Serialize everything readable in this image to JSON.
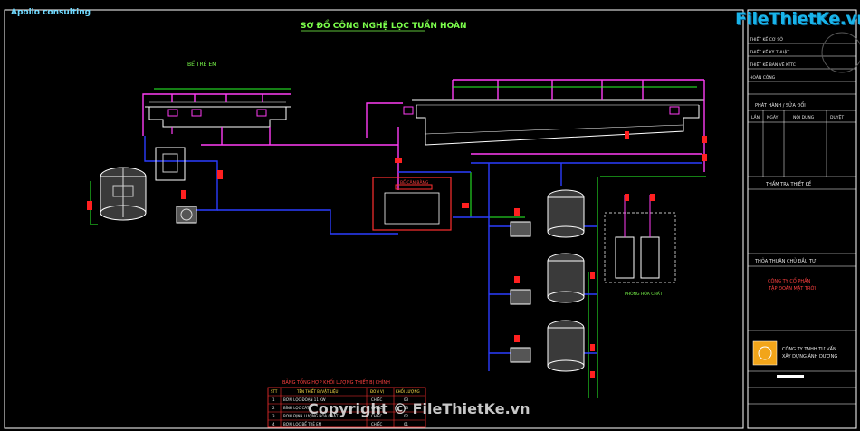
{
  "header": {
    "company": "Apollo consulting",
    "title": "SƠ ĐỒ CÔNG NGHỆ LỌC TUẦN HOÀN"
  },
  "brand": {
    "logo_text": "FileThietKe.vn",
    "copyright": "Copyright © FileThietKe.vn"
  },
  "labels": {
    "kids_pool": "BỂ TRẺ EM",
    "balance_tank": "BỂ CÂN BẰNG",
    "dosing_room": "PHÒNG HÓA CHẤT"
  },
  "title_block": {
    "rows": [
      "THIẾT KẾ CƠ SỞ",
      "THIẾT KẾ KỸ THUẬT",
      "THIẾT KẾ BẢN VẼ KTTC",
      "HOÀN CÔNG"
    ],
    "issue_header": "PHÁT HÀNH / SỬA ĐỔI",
    "cols": [
      "LẦN",
      "NGÀY",
      "NỘI DUNG",
      "DUYỆT"
    ],
    "review": "THẨM TRA THIẾT KẾ",
    "investor_agreement": "THỎA THUẬN CHỦ ĐẦU TƯ",
    "investor_line1": "CÔNG TY CỔ PHẦN",
    "investor_line2": "TẬP ĐOÀN MẶT TRỜI",
    "consultant_line1": "CÔNG TY TNHH TƯ VẤN",
    "consultant_line2": "XÂY DỰNG ÁNH DƯƠNG"
  },
  "table": {
    "title": "BẢNG TỔNG HỢP KHỐI LƯỢNG THIẾT BỊ CHÍNH",
    "headers": [
      "STT",
      "TÊN THIẾT BỊ/VẬT LIỆU",
      "ĐƠN VỊ",
      "KHỐI LƯỢNG"
    ],
    "rows": [
      [
        "1",
        "BƠM LỌC ĐOẠN 11 KW",
        "CHIẾC",
        "03"
      ],
      [
        "2",
        "BÌNH LỌC CÁT",
        "CHIẾC",
        "03"
      ],
      [
        "3",
        "BƠM ĐỊNH LƯỢNG HÓA CHẤT",
        "CHIẾC",
        "02"
      ],
      [
        "4",
        "BƠM LỌC BỂ TRẺ EM",
        "CHIẾC",
        "01"
      ]
    ]
  },
  "colors": {
    "pipe_supply": "#ff3df5",
    "pipe_return": "#2b3dff",
    "pipe_green": "#2aff2a",
    "valve": "#ff2020",
    "outline": "#ffffff"
  }
}
